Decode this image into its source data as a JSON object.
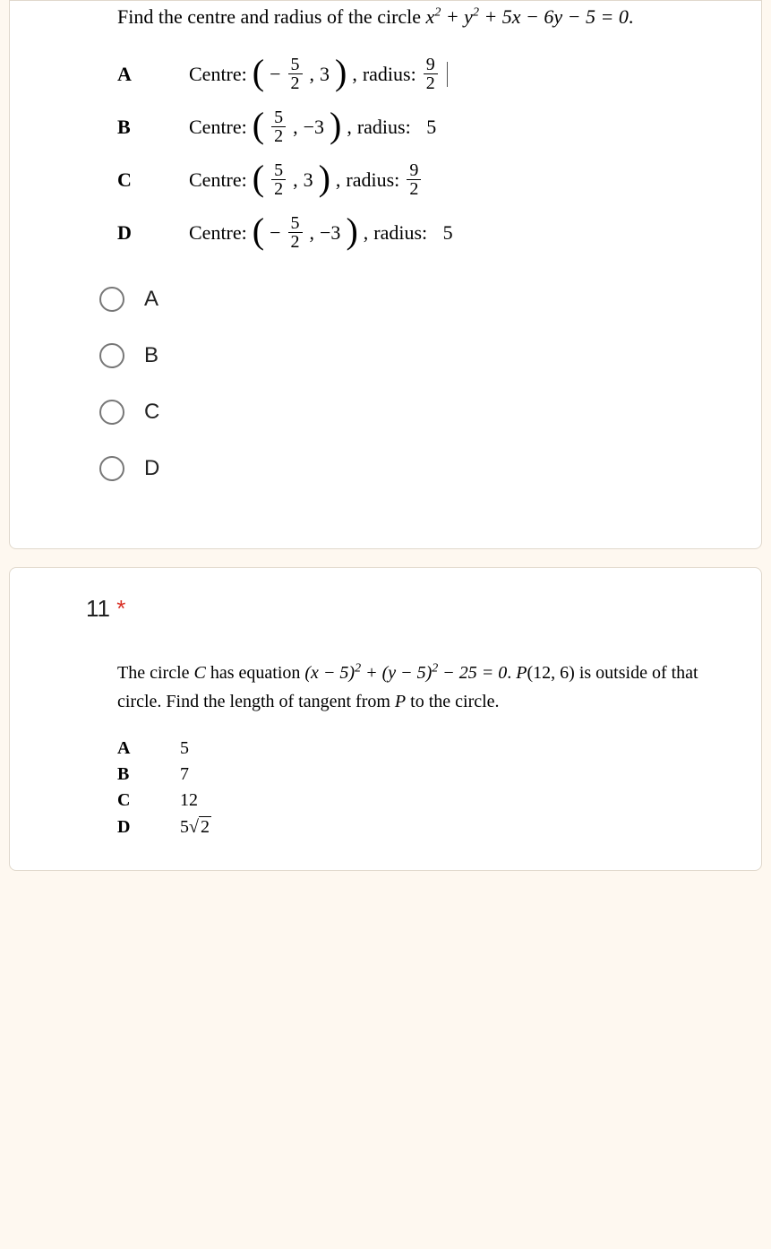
{
  "q10": {
    "prompt_prefix": "Find the centre and radius of the circle ",
    "equation": "x² + y² + 5x − 6y − 5 = 0",
    "options": {
      "A": {
        "letter": "A",
        "centre_label": "Centre:",
        "cx_neg": "−",
        "cx_num": "5",
        "cx_den": "2",
        "cy": "3",
        "radius_label": "radius:",
        "r_num": "9",
        "r_den": "2"
      },
      "B": {
        "letter": "B",
        "centre_label": "Centre:",
        "cx_num": "5",
        "cx_den": "2",
        "cy": "−3",
        "radius_label": "radius:",
        "r": "5"
      },
      "C": {
        "letter": "C",
        "centre_label": "Centre:",
        "cx_num": "5",
        "cx_den": "2",
        "cy": "3",
        "radius_label": "radius:",
        "r_num": "9",
        "r_den": "2"
      },
      "D": {
        "letter": "D",
        "centre_label": "Centre:",
        "cx_neg": "−",
        "cx_num": "5",
        "cx_den": "2",
        "cy": "−3",
        "radius_label": "radius:",
        "r": "5"
      }
    },
    "radios": {
      "A": "A",
      "B": "B",
      "C": "C",
      "D": "D"
    }
  },
  "q11": {
    "number": "11",
    "star": "*",
    "text_1": "The circle ",
    "C": "C",
    "text_2": " has equation ",
    "eq": "(x − 5)² + (y − 5)² − 25 = 0",
    "text_3": ". ",
    "P": "P(12, 6)",
    "text_4": " is outside of that circle. Find the length of tangent from ",
    "P2": "P",
    "text_5": " to the circle.",
    "options": {
      "A": {
        "letter": "A",
        "val": "5"
      },
      "B": {
        "letter": "B",
        "val": "7"
      },
      "C": {
        "letter": "C",
        "val": "12"
      },
      "D": {
        "letter": "D",
        "pre": "5",
        "sqrt": "2"
      }
    }
  },
  "chart_data": {
    "type": "table",
    "note": "multiple-choice math questions",
    "q10": {
      "equation": "x^2 + y^2 + 5x - 6y - 5 = 0",
      "choices": [
        {
          "id": "A",
          "centre": [
            -2.5,
            3
          ],
          "radius": 4.5
        },
        {
          "id": "B",
          "centre": [
            2.5,
            -3
          ],
          "radius": 5
        },
        {
          "id": "C",
          "centre": [
            2.5,
            3
          ],
          "radius": 4.5
        },
        {
          "id": "D",
          "centre": [
            -2.5,
            -3
          ],
          "radius": 5
        }
      ]
    },
    "q11": {
      "circle": "(x-5)^2 + (y-5)^2 - 25 = 0",
      "point": [
        12,
        6
      ],
      "choices": [
        {
          "id": "A",
          "value": 5
        },
        {
          "id": "B",
          "value": 7
        },
        {
          "id": "C",
          "value": 12
        },
        {
          "id": "D",
          "value": "5*sqrt(2)"
        }
      ]
    }
  }
}
